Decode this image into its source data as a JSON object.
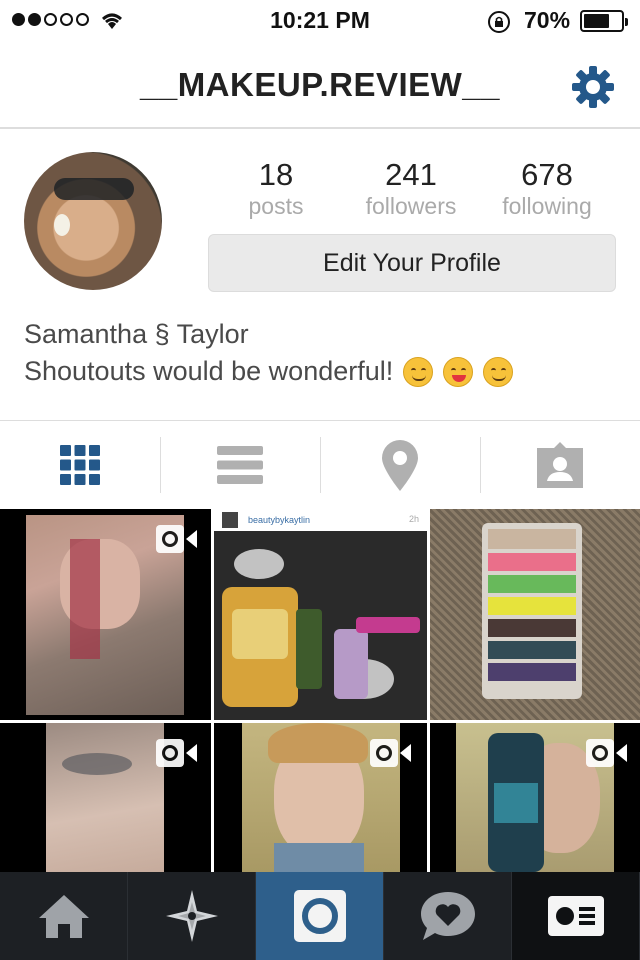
{
  "status_bar": {
    "time": "10:21 PM",
    "battery_percent": "70%",
    "signal_bars_filled": 2,
    "signal_bars_total": 5,
    "battery_level": 0.7
  },
  "header": {
    "title": "__MAKEUP.REVIEW__",
    "settings_icon": "gear-icon"
  },
  "profile": {
    "avatar_icon": "profile-photo",
    "stats": [
      {
        "value": "18",
        "label": "posts"
      },
      {
        "value": "241",
        "label": "followers"
      },
      {
        "value": "678",
        "label": "following"
      }
    ],
    "edit_button_label": "Edit Your Profile",
    "name": "Samantha § Taylor",
    "bio_text": "Shoutouts would be wonderful!",
    "bio_emojis": [
      "smiling-face-emoji",
      "squinting-tongue-emoji",
      "smiling-face-emoji"
    ]
  },
  "view_tabs": [
    {
      "icon": "grid-icon",
      "active": true
    },
    {
      "icon": "list-icon",
      "active": false
    },
    {
      "icon": "location-pin-icon",
      "active": false
    },
    {
      "icon": "tagged-photos-icon",
      "active": false
    }
  ],
  "grid": {
    "post_2": {
      "username": "beautybykaytlin",
      "time": "2h"
    }
  },
  "bottom_bar": [
    {
      "icon": "home-icon"
    },
    {
      "icon": "explore-icon"
    },
    {
      "icon": "camera-icon",
      "active": true
    },
    {
      "icon": "activity-icon"
    },
    {
      "icon": "profile-card-icon"
    }
  ],
  "colors": {
    "accent": "#2e5f8b",
    "active_icon": "#24588a",
    "inactive_icon": "#b0b0b0",
    "bottom_bar": "#1d2024"
  }
}
